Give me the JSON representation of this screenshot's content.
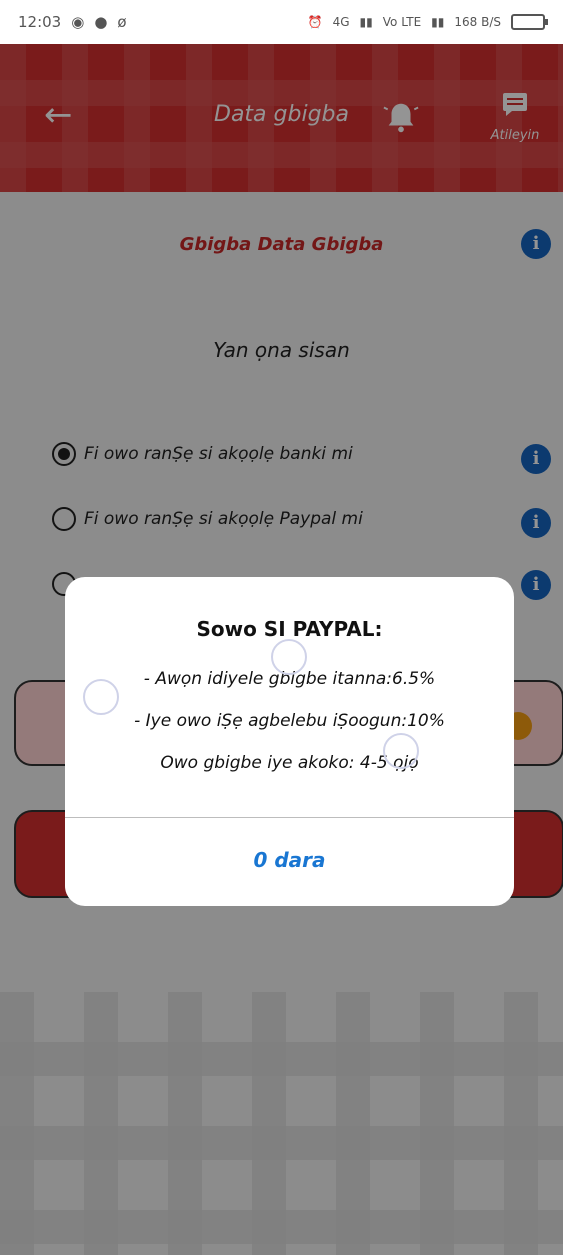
{
  "status_bar": {
    "time": "12:03",
    "network_labels": [
      "4G",
      "Vo LTE",
      "168 B/S"
    ]
  },
  "app_bar": {
    "title": "Data gbigba",
    "support_label": "Atileyin"
  },
  "main": {
    "subtitle": "Gbigba Data Gbigba",
    "prompt": "Yan ọna sisan",
    "options": [
      {
        "label": "Fi owo ranṢẹ si akọọlẹ banki mi",
        "selected": true
      },
      {
        "label": "Fi owo ranṢẹ si akọọlẹ Paypal mi",
        "selected": false
      },
      {
        "label": "",
        "selected": false
      }
    ]
  },
  "dialog": {
    "title": "Sowo SI PAYPAL:",
    "lines": [
      "- Awọn idiyele gbigbe itanna:6.5%",
      "- Iye owo iṢẹ agbelebu iṢoogun:10%",
      "Owo gbigbe iye akoko: 4-5 ọjọ"
    ],
    "ok_label": "0 dara"
  },
  "colors": {
    "primary": "#d32f2f",
    "info": "#1565c0",
    "accent_link": "#1976d2"
  }
}
